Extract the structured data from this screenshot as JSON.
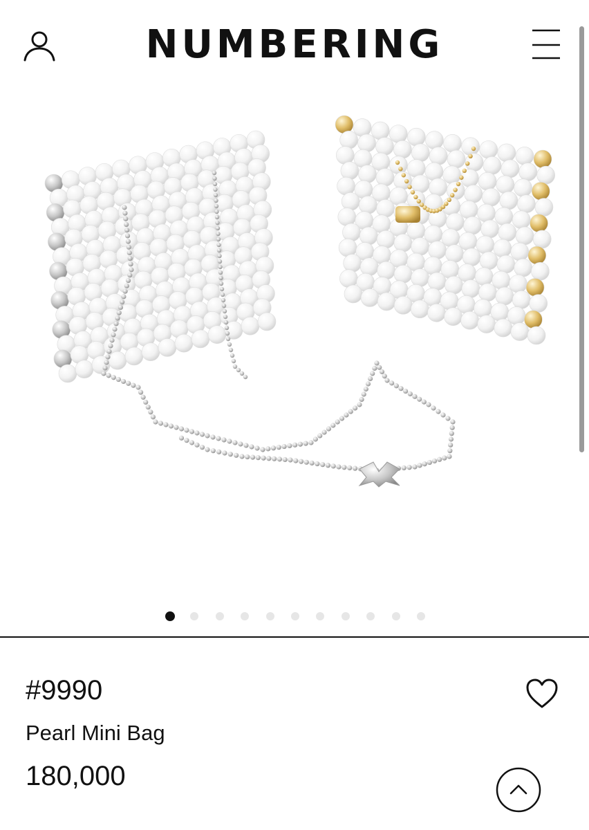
{
  "header": {
    "logo": "NUMBERING",
    "icons": {
      "user": "user-icon",
      "menu": "hamburger-menu-icon"
    }
  },
  "gallery": {
    "image": "pearl-mini-bag-photo",
    "slide_count": 11,
    "active_slide": 1
  },
  "product": {
    "number": "#9990",
    "name": "Pearl Mini Bag",
    "price": "180,000",
    "wishlist_icon": "heart-icon"
  },
  "scroll_top": {
    "icon": "chevron-up-icon"
  },
  "colors": {
    "text": "#111111",
    "dot_inactive": "#e6e6e6",
    "pearl": "#f4f4f4",
    "gold": "#d8b25a"
  }
}
